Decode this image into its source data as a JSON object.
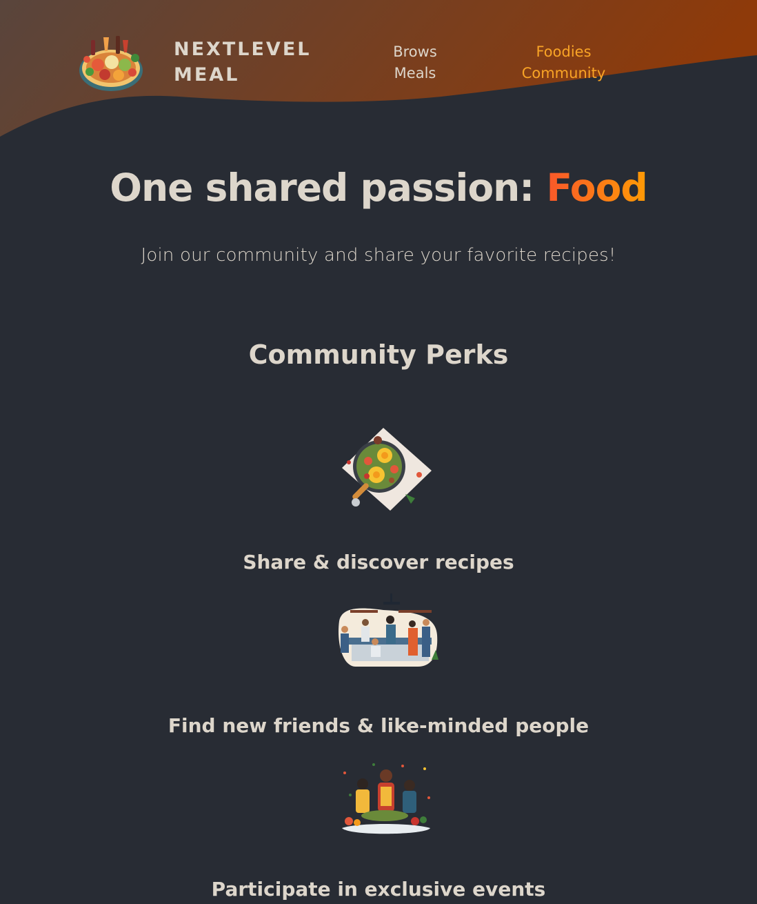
{
  "header": {
    "logo": {
      "alt": "A plate with food on it",
      "line1": "NEXTLEVEL",
      "line2": "MEAL"
    },
    "nav": [
      {
        "line1": "Brows",
        "line2": "Meals",
        "active": false
      },
      {
        "line1": "Foodies",
        "line2": "Community",
        "active": true
      }
    ]
  },
  "hero": {
    "title_prefix": "One shared passion: ",
    "title_accent": "Food",
    "subtitle": "Join our community and share your favorite recipes!"
  },
  "perks": {
    "title": "Community Perks",
    "items": [
      {
        "label": "Share & discover recipes",
        "icon": "food-pan-illustration"
      },
      {
        "label": "Find new friends & like-minded people",
        "icon": "kitchen-people-illustration"
      },
      {
        "label": "Participate in exclusive events",
        "icon": "cooking-event-illustration"
      }
    ]
  },
  "colors": {
    "background": "#282c34",
    "text": "#ddd6cb",
    "accent_start": "#f9572a",
    "accent_end": "#ff9b05",
    "nav_active": "#f9a426",
    "header_gradient_start": "#59453c",
    "header_gradient_end": "#8f3a09"
  }
}
